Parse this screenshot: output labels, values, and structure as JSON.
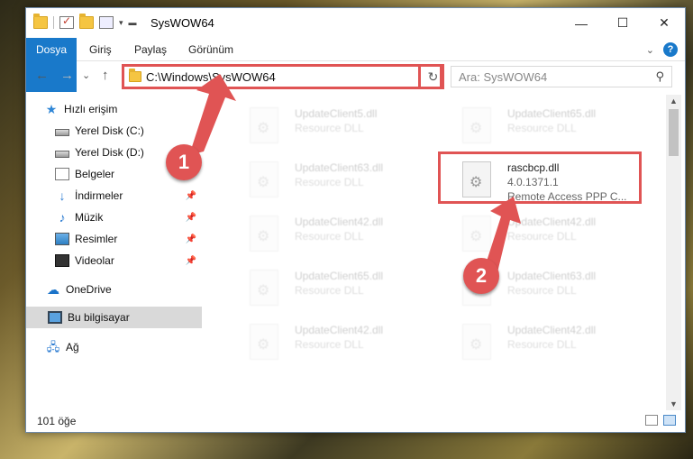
{
  "window": {
    "title": "SysWOW64",
    "controls": {
      "minimize": "—",
      "maximize": "☐",
      "close": "✕"
    }
  },
  "ribbon": {
    "tabs": [
      "Dosya",
      "Giriş",
      "Paylaş",
      "Görünüm"
    ],
    "help": "?"
  },
  "navigation": {
    "back": "←",
    "forward": "→",
    "recent": "⌄",
    "up": "↑",
    "address": "C:\\Windows\\SysWOW64",
    "refresh": "↻",
    "search_placeholder": "Ara: SysWOW64"
  },
  "sidebar": {
    "items": [
      {
        "label": "Hızlı erişim",
        "icon": "star-icon"
      },
      {
        "label": "Yerel Disk (C:)",
        "icon": "disk-icon"
      },
      {
        "label": "Yerel Disk (D:)",
        "icon": "disk-icon"
      },
      {
        "label": "Belgeler",
        "icon": "document-icon"
      },
      {
        "label": "İndirmeler",
        "icon": "download-icon",
        "pinned": true
      },
      {
        "label": "Müzik",
        "icon": "music-icon",
        "pinned": true
      },
      {
        "label": "Resimler",
        "icon": "pictures-icon",
        "pinned": true
      },
      {
        "label": "Videolar",
        "icon": "video-icon",
        "pinned": true
      },
      {
        "label": "OneDrive",
        "icon": "cloud-icon"
      },
      {
        "label": "Bu bilgisayar",
        "icon": "computer-icon",
        "selected": true
      },
      {
        "label": "Ağ",
        "icon": "network-icon"
      }
    ]
  },
  "files": [
    {
      "name": "UpdateClient5.dll",
      "type": "Resource DLL"
    },
    {
      "name": "UpdateClient65.dll",
      "type": "Resource DLL"
    },
    {
      "name": "UpdateClient63.dll",
      "type": "Resource DLL"
    },
    {
      "name": "rascbcp.dll",
      "version": "4.0.1371.1",
      "description": "Remote Access PPP C..."
    },
    {
      "name": "UpdateClient42.dll",
      "type": "Resource DLL"
    },
    {
      "name": "UpdateClient42.dll",
      "type": "Resource DLL"
    },
    {
      "name": "UpdateClient65.dll",
      "type": "Resource DLL"
    },
    {
      "name": "UpdateClient63.dll",
      "type": "Resource DLL"
    },
    {
      "name": "UpdateClient42.dll",
      "type": "Resource DLL"
    },
    {
      "name": "UpdateClient42.dll",
      "type": "Resource DLL"
    }
  ],
  "status": {
    "count": "101 öğe"
  },
  "callouts": {
    "one": "1",
    "two": "2"
  },
  "colors": {
    "accent": "#1979ca",
    "highlight": "#e05454"
  }
}
